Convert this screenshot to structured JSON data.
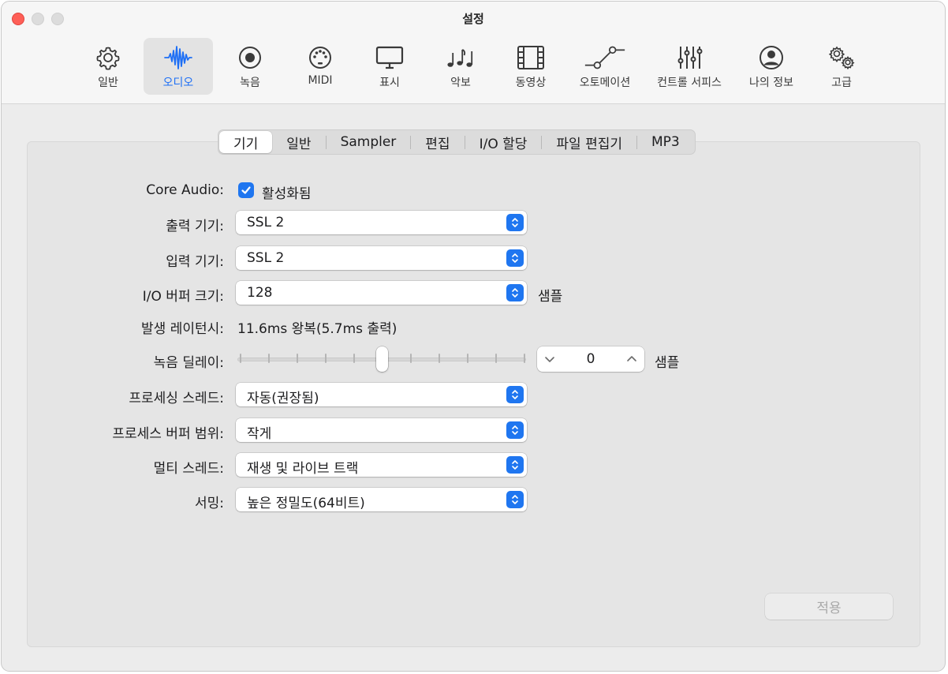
{
  "window": {
    "title": "설정"
  },
  "toolbar": {
    "items": [
      {
        "label": "일반",
        "icon": "gear-icon"
      },
      {
        "label": "오디오",
        "icon": "waveform-icon",
        "active": true
      },
      {
        "label": "녹음",
        "icon": "record-icon"
      },
      {
        "label": "MIDI",
        "icon": "midi-port-icon"
      },
      {
        "label": "표시",
        "icon": "display-icon"
      },
      {
        "label": "악보",
        "icon": "music-notes-icon"
      },
      {
        "label": "동영상",
        "icon": "film-icon"
      },
      {
        "label": "오토메이션",
        "icon": "automation-curve-icon"
      },
      {
        "label": "컨트롤 서피스",
        "icon": "faders-icon"
      },
      {
        "label": "나의 정보",
        "icon": "person-icon"
      },
      {
        "label": "고급",
        "icon": "gears-icon"
      }
    ]
  },
  "tabs": [
    {
      "label": "기기",
      "active": true
    },
    {
      "label": "일반"
    },
    {
      "label": "Sampler"
    },
    {
      "label": "편집"
    },
    {
      "label": "I/O 할당"
    },
    {
      "label": "파일 편집기"
    },
    {
      "label": "MP3"
    }
  ],
  "form": {
    "core_audio": {
      "label": "Core Audio:",
      "checkbox_label": "활성화됨",
      "checked": true
    },
    "output_device": {
      "label": "출력 기기:",
      "value": "SSL 2"
    },
    "input_device": {
      "label": "입력 기기:",
      "value": "SSL 2"
    },
    "io_buffer": {
      "label": "I/O 버퍼 크기:",
      "value": "128",
      "unit": "샘플"
    },
    "latency": {
      "label": "발생 레이턴시:",
      "value": "11.6ms 왕복(5.7ms 출력)"
    },
    "record_delay": {
      "label": "녹음 딜레이:",
      "value": "0",
      "unit": "샘플"
    },
    "processing_threads": {
      "label": "프로세싱 스레드:",
      "value": "자동(권장됨)"
    },
    "process_buffer_range": {
      "label": "프로세스 버퍼 범위:",
      "value": "작게"
    },
    "multithreading": {
      "label": "멀티 스레드:",
      "value": "재생 및 라이브 트랙"
    },
    "summing": {
      "label": "서밍:",
      "value": "높은 정밀도(64비트)"
    }
  },
  "apply_button": {
    "label": "적용",
    "enabled": false
  },
  "colors": {
    "accent": "#1f76f0",
    "close": "#fe5f57"
  }
}
